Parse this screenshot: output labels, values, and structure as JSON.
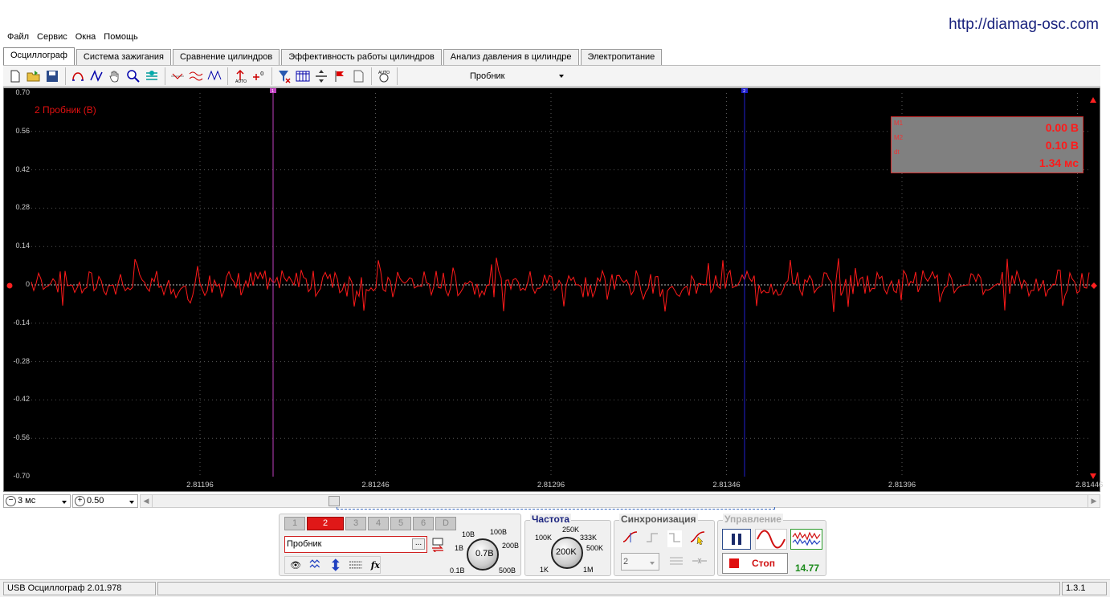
{
  "website_url": "http://diamag-osc.com",
  "menu": [
    "Файл",
    "Сервис",
    "Окна",
    "Помощь"
  ],
  "tabs": [
    {
      "label": "Осциллограф",
      "active": true
    },
    {
      "label": "Система зажигания",
      "active": false
    },
    {
      "label": "Сравнение цилиндров",
      "active": false
    },
    {
      "label": "Эффективность работы цилиндров",
      "active": false
    },
    {
      "label": "Анализ давления в цилиндре",
      "active": false
    },
    {
      "label": "Электропитание",
      "active": false
    }
  ],
  "toolbar": {
    "probe_dropdown": "Пробник"
  },
  "scope": {
    "channel_title": "2 Пробник (В)",
    "y_ticks": [
      "0.70",
      "0.56",
      "0.42",
      "0.28",
      "0.14",
      "0",
      "-0.14",
      "-0.28",
      "-0.42",
      "-0.56",
      "-0.70"
    ],
    "x_ticks": [
      "2.81196",
      "2.81246",
      "2.81296",
      "2.81346",
      "2.81396",
      "2.81446"
    ],
    "marker1_label": "1",
    "marker2_label": "2",
    "trace_color": "#ff1a1a",
    "marker1_color": "#c040c0",
    "marker2_color": "#2020d0"
  },
  "measurements": {
    "m1_label": "M1",
    "m1_value": "0.00 В",
    "m2_label": "M2",
    "m2_value": "0.10 В",
    "dt_label": "dt",
    "dt_value": "1.34 мс"
  },
  "timebase": {
    "value": "3 мс",
    "zoom": "0.50"
  },
  "channels": {
    "buttons": [
      "1",
      "2",
      "3",
      "4",
      "5",
      "6",
      "D"
    ],
    "active": "2",
    "probe_input": "Пробник",
    "probe_browse": "..."
  },
  "voltage_knob": {
    "value": "0.7В",
    "labels": [
      "10В",
      "100В",
      "1В",
      "200В",
      "0.1В",
      "500В"
    ]
  },
  "frequency": {
    "title": "Частота",
    "value": "200K",
    "labels": [
      "250K",
      "100K",
      "333K",
      "500K",
      "1K",
      "1M"
    ]
  },
  "sync": {
    "title": "Синхронизация",
    "channel": "2"
  },
  "control": {
    "title": "Управление",
    "stop_label": "Стоп",
    "fps": "14.77"
  },
  "status": {
    "left": "USB Осциллограф  2.01.978",
    "right": "1.3.1"
  }
}
